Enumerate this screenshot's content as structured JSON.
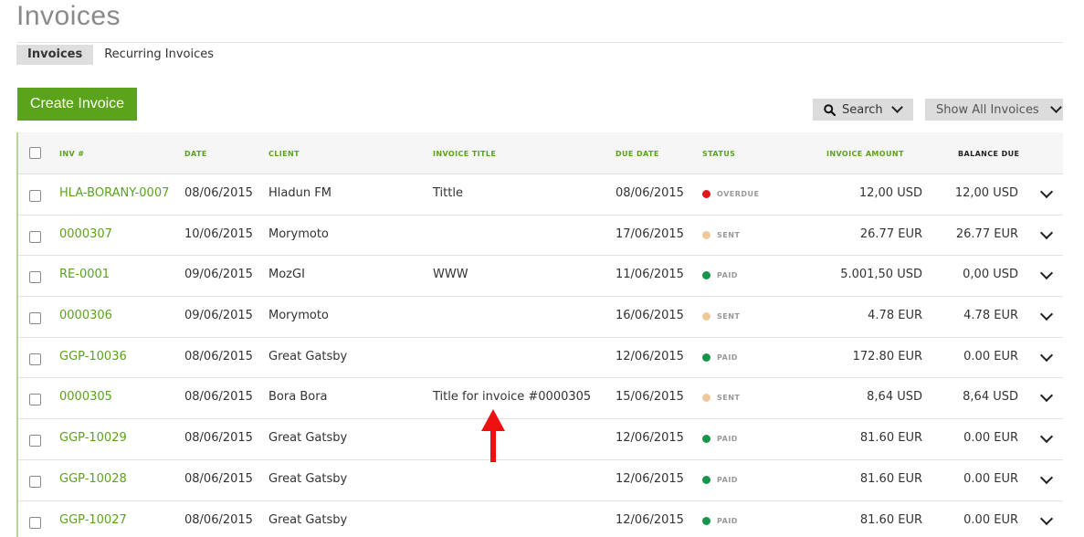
{
  "page": {
    "title": "Invoices"
  },
  "tabs": [
    {
      "label": "Invoices",
      "active": true
    },
    {
      "label": "Recurring Invoices",
      "active": false
    }
  ],
  "toolbar": {
    "create_label": "Create Invoice",
    "search_label": "Search",
    "filter_label": "Show All Invoices"
  },
  "colors": {
    "accent": "#5ba31a",
    "overdue": "#e4151b",
    "sent": "#f0c99a",
    "paid": "#16964a",
    "annotation_arrow": "#ee1111"
  },
  "table": {
    "headers": [
      "INV #",
      "DATE",
      "CLIENT",
      "INVOICE TITLE",
      "DUE DATE",
      "STATUS",
      "INVOICE AMOUNT",
      "BALANCE DUE"
    ],
    "rows": [
      {
        "inv": "HLA-BORANY-0007",
        "date": "08/06/2015",
        "client": "Hladun FM",
        "title": "Tittle",
        "due": "08/06/2015",
        "status": "OVERDUE",
        "status_color": "#e4151b",
        "amount": "12,00 USD",
        "balance": "12,00 USD"
      },
      {
        "inv": "0000307",
        "date": "10/06/2015",
        "client": "Morymoto",
        "title": "",
        "due": "17/06/2015",
        "status": "SENT",
        "status_color": "#f0c99a",
        "amount": "26.77 EUR",
        "balance": "26.77 EUR"
      },
      {
        "inv": "RE-0001",
        "date": "09/06/2015",
        "client": "MozGI",
        "title": "WWW",
        "due": "11/06/2015",
        "status": "PAID",
        "status_color": "#16964a",
        "amount": "5.001,50 USD",
        "balance": "0,00 USD"
      },
      {
        "inv": "0000306",
        "date": "09/06/2015",
        "client": "Morymoto",
        "title": "",
        "due": "16/06/2015",
        "status": "SENT",
        "status_color": "#f0c99a",
        "amount": "4.78 EUR",
        "balance": "4.78 EUR"
      },
      {
        "inv": "GGP-10036",
        "date": "08/06/2015",
        "client": "Great Gatsby",
        "title": "",
        "due": "12/06/2015",
        "status": "PAID",
        "status_color": "#16964a",
        "amount": "172.80 EUR",
        "balance": "0.00 EUR"
      },
      {
        "inv": "0000305",
        "date": "08/06/2015",
        "client": "Bora Bora",
        "title": "Title for invoice #0000305",
        "due": "15/06/2015",
        "status": "SENT",
        "status_color": "#f0c99a",
        "amount": "8,64 USD",
        "balance": "8,64 USD"
      },
      {
        "inv": "GGP-10029",
        "date": "08/06/2015",
        "client": "Great Gatsby",
        "title": "",
        "due": "12/06/2015",
        "status": "PAID",
        "status_color": "#16964a",
        "amount": "81.60 EUR",
        "balance": "0.00 EUR"
      },
      {
        "inv": "GGP-10028",
        "date": "08/06/2015",
        "client": "Great Gatsby",
        "title": "",
        "due": "12/06/2015",
        "status": "PAID",
        "status_color": "#16964a",
        "amount": "81.60 EUR",
        "balance": "0.00 EUR"
      },
      {
        "inv": "GGP-10027",
        "date": "08/06/2015",
        "client": "Great Gatsby",
        "title": "",
        "due": "12/06/2015",
        "status": "PAID",
        "status_color": "#16964a",
        "amount": "81.60 EUR",
        "balance": "0.00 EUR"
      }
    ]
  },
  "icons": {
    "search": "search-icon",
    "dropdown": "chevron-down-icon",
    "row_menu": "chevron-down-icon",
    "annotation": "red-up-arrow"
  }
}
